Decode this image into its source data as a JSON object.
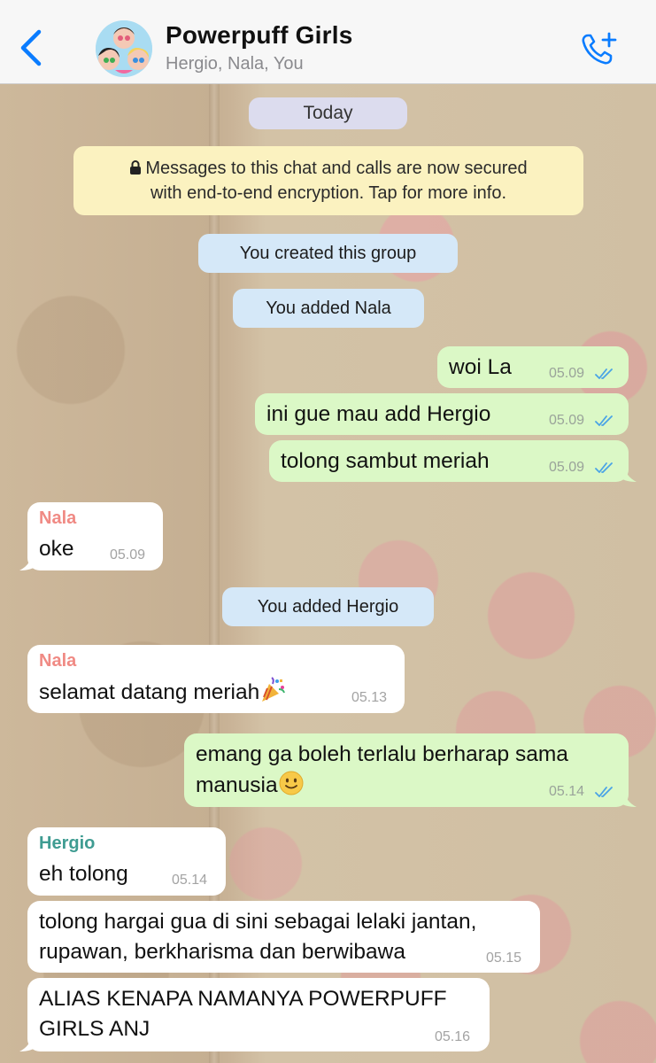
{
  "header": {
    "title": "Powerpuff Girls",
    "subtitle": "Hergio, Nala, You",
    "accent_color": "#0a7cff",
    "back_icon": "chevron-left-icon",
    "call_icon": "add-call-icon"
  },
  "chat": {
    "date_pill": "Today",
    "encryption_notice": {
      "line1": "Messages to this chat and calls are now secured",
      "line2": "with end-to-end encryption. Tap for more info."
    },
    "system": {
      "created": "You created this group",
      "added_nala": "You added Nala",
      "added_hergio": "You added Hergio"
    },
    "messages": {
      "m1": {
        "text": "woi La",
        "time": "05.09"
      },
      "m2": {
        "text": "ini gue mau add Hergio",
        "time": "05.09"
      },
      "m3": {
        "text": "tolong sambut meriah",
        "time": "05.09"
      },
      "m4": {
        "sender": "Nala",
        "text": "oke",
        "time": "05.09"
      },
      "m5": {
        "sender": "Nala",
        "text": "selamat datang meriah",
        "time": "05.13"
      },
      "m6": {
        "line1": "emang ga boleh terlalu berharap sama",
        "line2": "manusia",
        "time": "05.14"
      },
      "m7": {
        "sender": "Hergio",
        "text": "eh tolong",
        "time": "05.14"
      },
      "m8": {
        "line1": "tolong hargai gua di sini sebagai lelaki jantan,",
        "line2": "rupawan, berkharisma dan berwibawa",
        "time": "05.15"
      },
      "m9": {
        "line1": "ALIAS KENAPA NAMANYA POWERPUFF",
        "line2": "GIRLS ANJ",
        "time": "05.16"
      }
    },
    "colors": {
      "outgoing_bubble": "#dbf8c6",
      "incoming_bubble": "#ffffff",
      "nala_name": "#f08a84",
      "hergio_name": "#3f9c92",
      "read_ticks": "#4aa3e6"
    }
  }
}
